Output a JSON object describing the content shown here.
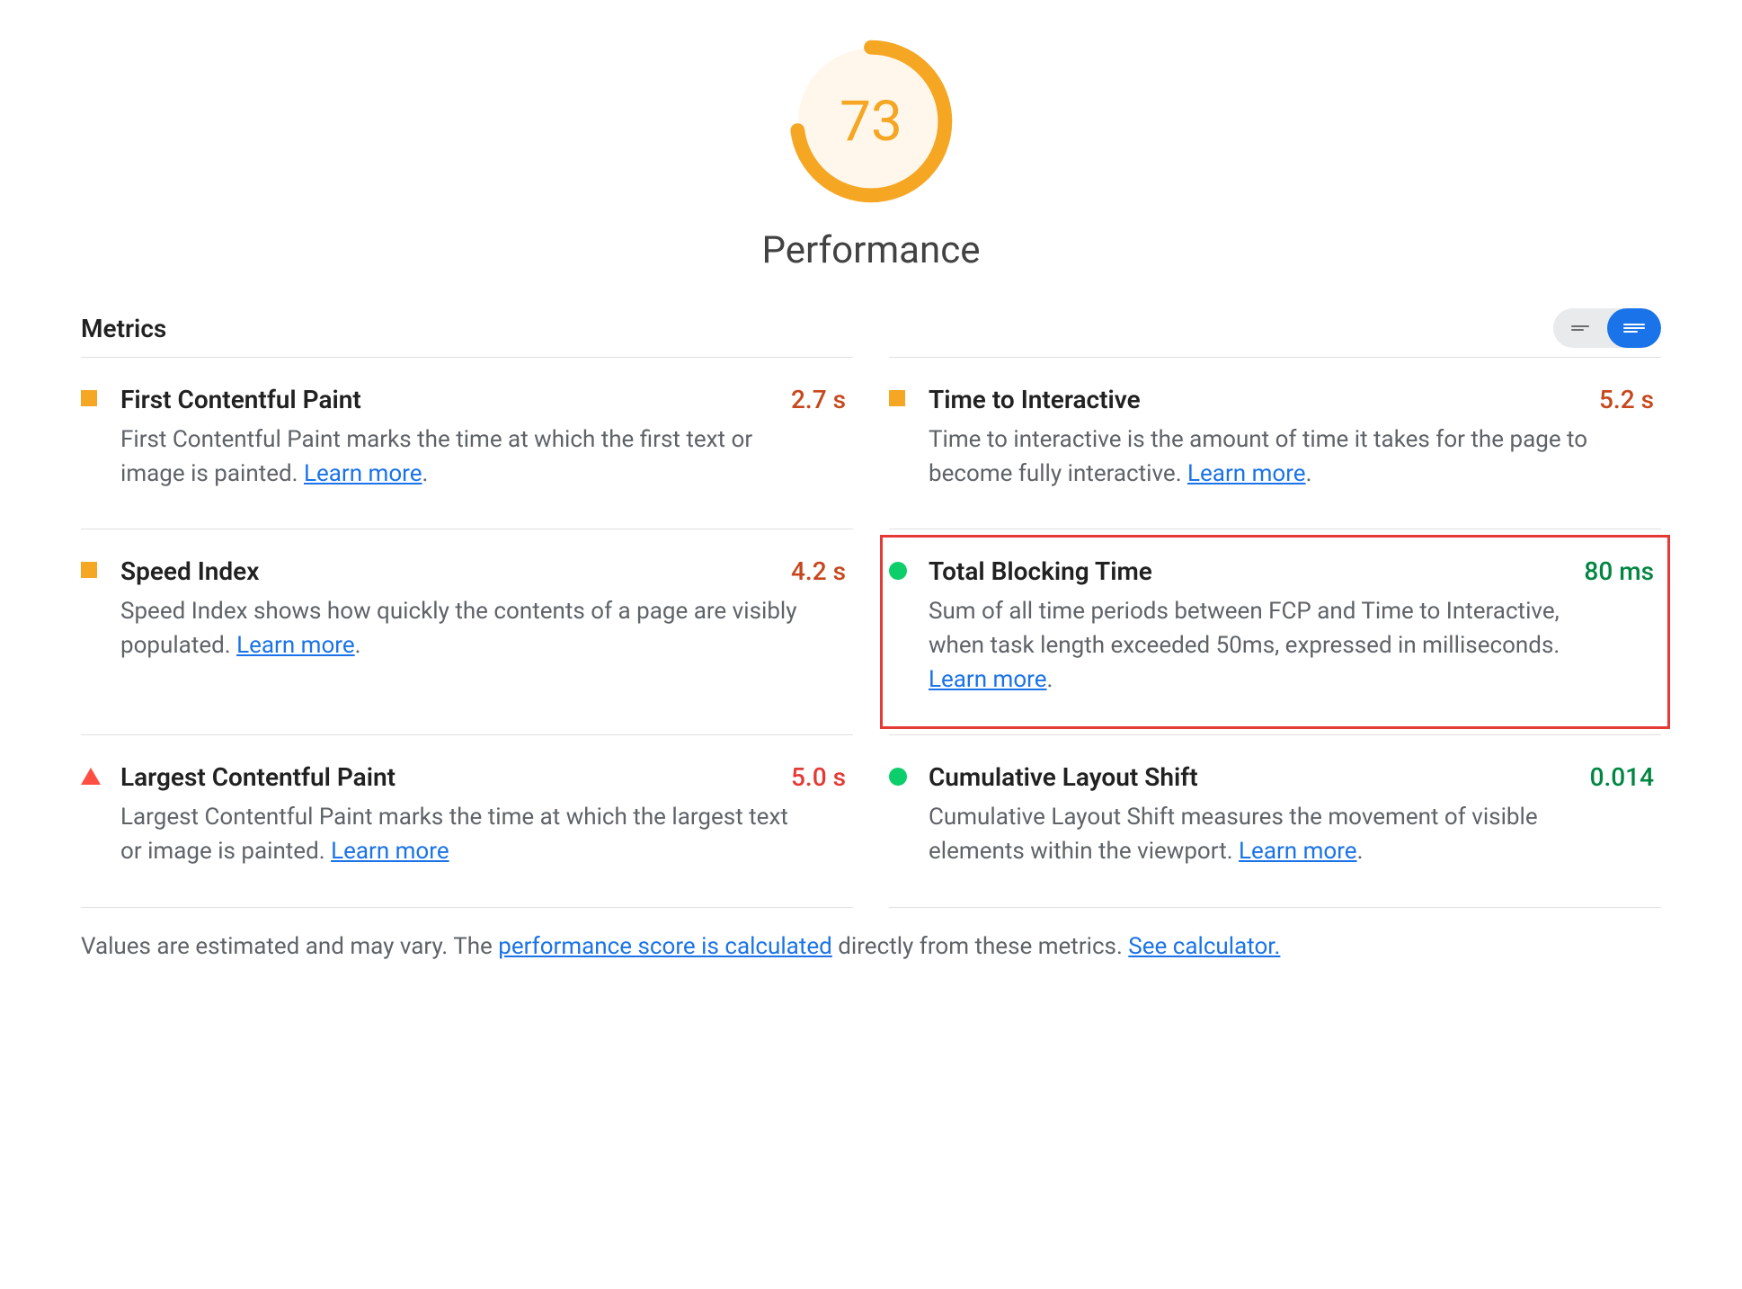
{
  "score": {
    "value": "73",
    "label": "Performance",
    "percent": 73,
    "ring_color": "#F5A623",
    "fill_color": "#FFF7EB"
  },
  "section_title": "Metrics",
  "toggle": {
    "compact_active": false,
    "expanded_active": true
  },
  "metrics": [
    {
      "id": "fcp",
      "title": "First Contentful Paint",
      "value": "2.7 s",
      "status": "average",
      "value_color": "orange",
      "description_pre": "First Contentful Paint marks the time at which the first text or image is painted. ",
      "learn_more": "Learn more",
      "description_post": "."
    },
    {
      "id": "tti",
      "title": "Time to Interactive",
      "value": "5.2 s",
      "status": "average",
      "value_color": "orange",
      "description_pre": "Time to interactive is the amount of time it takes for the page to become fully interactive. ",
      "learn_more": "Learn more",
      "description_post": "."
    },
    {
      "id": "si",
      "title": "Speed Index",
      "value": "4.2 s",
      "status": "average",
      "value_color": "orange",
      "description_pre": "Speed Index shows how quickly the contents of a page are visibly populated. ",
      "learn_more": "Learn more",
      "description_post": "."
    },
    {
      "id": "tbt",
      "title": "Total Blocking Time",
      "value": "80 ms",
      "status": "good",
      "value_color": "green",
      "highlight": true,
      "description_pre": "Sum of all time periods between FCP and Time to Interactive, when task length exceeded 50ms, expressed in milliseconds. ",
      "learn_more": "Learn more",
      "description_post": "."
    },
    {
      "id": "lcp",
      "title": "Largest Contentful Paint",
      "value": "5.0 s",
      "status": "poor",
      "value_color": "red",
      "description_pre": "Largest Contentful Paint marks the time at which the largest text or image is painted. ",
      "learn_more": "Learn more",
      "description_post": ""
    },
    {
      "id": "cls",
      "title": "Cumulative Layout Shift",
      "value": "0.014",
      "status": "good",
      "value_color": "green",
      "description_pre": "Cumulative Layout Shift measures the movement of visible elements within the viewport. ",
      "learn_more": "Learn more",
      "description_post": "."
    }
  ],
  "footer": {
    "pre": "Values are estimated and may vary. The ",
    "link1": "performance score is calculated",
    "mid": " directly from these metrics. ",
    "link2": "See calculator."
  }
}
